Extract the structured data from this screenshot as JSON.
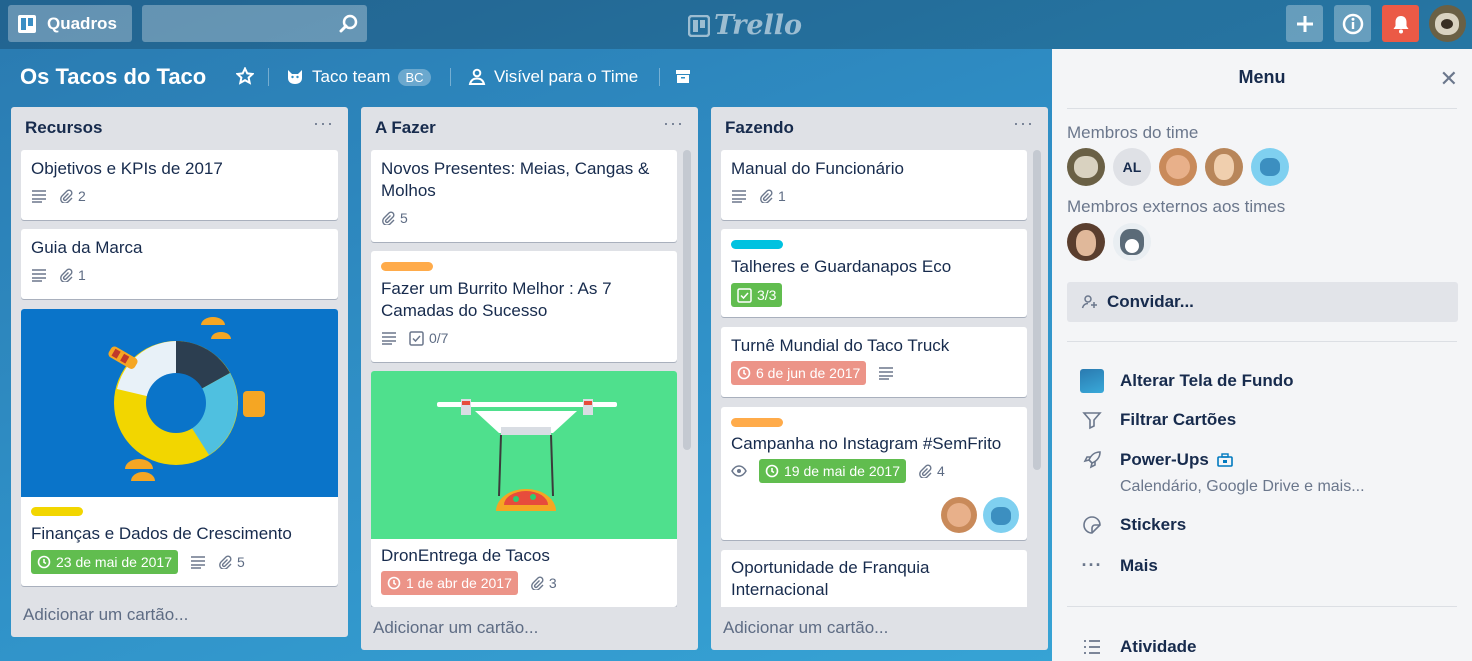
{
  "topbar": {
    "boards_label": "Quadros",
    "logo_text": "Trello",
    "search_value": ""
  },
  "board": {
    "title": "Os Tacos do Taco",
    "team": "Taco team",
    "team_badge": "BC",
    "visibility": "Visível para o Time"
  },
  "lists": [
    {
      "title": "Recursos",
      "add_card": "Adicionar um cartão...",
      "cards": [
        {
          "title": "Objetivos e KPIs de 2017",
          "attachments": "2"
        },
        {
          "title": "Guia da Marca",
          "attachments": "1"
        },
        {
          "title": "Finanças e Dados de Crescimento",
          "label_color": "#f2d600",
          "due": "23 de mai de 2017",
          "attachments": "5"
        }
      ]
    },
    {
      "title": "A Fazer",
      "add_card": "Adicionar um cartão...",
      "cards": [
        {
          "title": "Novos Presentes: Meias, Cangas & Molhos",
          "attachments": "5"
        },
        {
          "title": "Fazer um Burrito Melhor : As 7 Camadas do Sucesso",
          "label_color": "#ffab4a",
          "checklist": "0/7"
        },
        {
          "title": "DronEntrega de Tacos",
          "due": "1 de abr de 2017",
          "attachments": "3"
        }
      ]
    },
    {
      "title": "Fazendo",
      "add_card": "Adicionar um cartão...",
      "cards": [
        {
          "title": "Manual do Funcionário",
          "attachments": "1"
        },
        {
          "title": "Talheres e Guardanapos Eco",
          "label_color": "#00c2e0",
          "checklist": "3/3"
        },
        {
          "title": "Turnê Mundial do Taco Truck",
          "due": "6 de jun de 2017"
        },
        {
          "title": "Campanha no Instagram #SemFrito",
          "label_color": "#ffab4a",
          "due": "19 de mai de 2017",
          "attachments": "4"
        },
        {
          "title": "Oportunidade de Franquia Internacional"
        }
      ]
    }
  ],
  "menu": {
    "title": "Menu",
    "team_members_label": "Membros do time",
    "team_member_initials": "AL",
    "external_members_label": "Membros externos aos times",
    "invite_label": "Convidar...",
    "items": [
      {
        "label": "Alterar Tela de Fundo",
        "icon": "background-swatch-icon"
      },
      {
        "label": "Filtrar Cartões",
        "icon": "filter-icon"
      },
      {
        "label": "Power-Ups",
        "icon": "rocket-icon",
        "sub": "Calendário, Google Drive e mais..."
      },
      {
        "label": "Stickers",
        "icon": "sticker-icon"
      },
      {
        "label": "Mais",
        "icon": "more-icon"
      }
    ],
    "activity_label": "Atividade"
  },
  "colors": {
    "accent": "#0079bf",
    "green": "#61bd4f",
    "red": "#eb5a46",
    "overdue": "#ec9488",
    "orange": "#ffab4a",
    "yellow": "#f2d600",
    "cyan": "#00c2e0"
  }
}
